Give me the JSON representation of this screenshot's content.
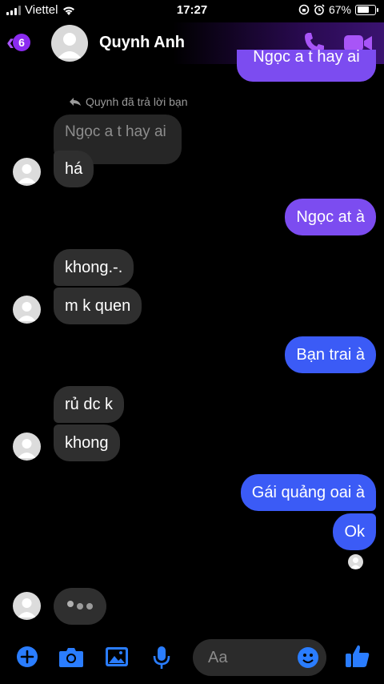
{
  "status_bar": {
    "carrier": "Viettel",
    "time": "17:27",
    "battery": "67%"
  },
  "header": {
    "back_count": "6",
    "contact_name": "Quynh Anh"
  },
  "reply_note": "Quynh đã trả lời bạn",
  "quoted_message": "Ngọc a t hay ai",
  "top_cut_message": "Ngọc a t hay ai",
  "messages": {
    "m1": "há",
    "m2": "Ngọc at à",
    "m3": "khong.-.",
    "m4": "m k quen",
    "m5": "Bạn trai à",
    "m6": "rủ dc k",
    "m7": "khong",
    "m8": "Gái quảng oai à",
    "m9": "Ok"
  },
  "composer": {
    "placeholder": "Aa"
  },
  "colors": {
    "accent": "#a855f7",
    "bubble_purple": "#7c4cf0",
    "bubble_blue": "#3b5bf6",
    "bubble_gray": "#2f2f2f",
    "composer_blue": "#2a7dff"
  },
  "icons": [
    "signal-icon",
    "wifi-icon",
    "lock-rotation-icon",
    "alarm-icon",
    "battery-icon",
    "back-chevron-icon",
    "phone-icon",
    "video-icon",
    "reply-icon",
    "plus-icon",
    "camera-icon",
    "image-icon",
    "mic-icon",
    "emoji-icon",
    "thumbs-up-icon"
  ]
}
